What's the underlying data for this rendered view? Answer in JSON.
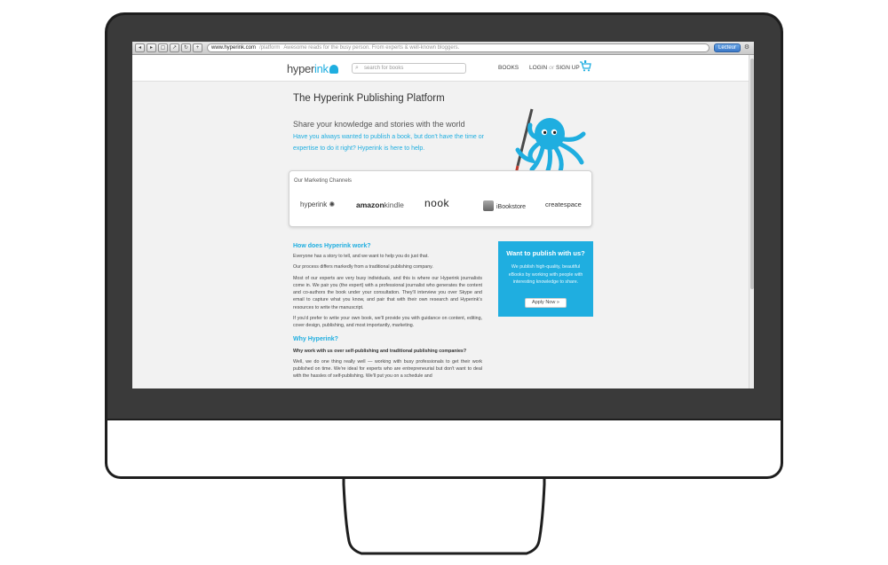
{
  "browser": {
    "url": "www.hyperink.com",
    "url_path": "/platform",
    "title": "Awesome reads for the busy person. From experts & well-known bloggers.",
    "reader_button": "Lecteur",
    "nav_icons": [
      "back-icon",
      "forward-icon",
      "tabs-icon",
      "share-icon",
      "reload-icon",
      "settings-icon"
    ]
  },
  "header": {
    "logo_text": "hyper",
    "logo_accent": "ink",
    "search_placeholder": "search for books",
    "nav_books": "BOOKS",
    "nav_login": "LOGIN",
    "nav_or": "or",
    "nav_signup": "SIGN UP"
  },
  "hero": {
    "title": "The Hyperink Publishing Platform",
    "tagline": "Share your knowledge and stories with the world",
    "intro": "Have you always wanted to publish a book, but don't have the time or expertise to do it right? Hyperink is here to help."
  },
  "channels": {
    "title": "Our Marketing Channels",
    "items": [
      "hyperink",
      "amazon",
      "kindle",
      "nook",
      "iBookstore",
      "createspace"
    ]
  },
  "article": {
    "heading1": "How does Hyperink work?",
    "p1": "Everyone has a story to tell, and we want to help you do just that.",
    "p2": "Our process differs markedly from a traditional publishing company.",
    "p3": "Most of our experts are very busy individuals, and this is where our Hyperink journalists come in. We pair you (the expert) with a professional journalist who generates the content and co-authors the book under your consultation. They'll interview you over Skype and email to capture what you know, and pair that with their own research and Hyperink's resources to write the manuscript.",
    "p4": "If you'd prefer to write your own book, we'll provide you with guidance on content, editing, cover design, publishing, and most importantly, marketing.",
    "heading2": "Why Hyperink?",
    "bold": "Why work with us over self-publishing and traditional publishing companies?",
    "p5": "Well, we do one thing really well — working with busy professionals to get their work published on time. We're ideal for experts who are entrepreneurial but don't want to deal with the hassles of self-publishing. We'll put you on a schedule and"
  },
  "promo": {
    "title": "Want to publish with us?",
    "text": "We publish high-quality, beautiful eBooks by working with people with interesting knowledge to share.",
    "button": "Apply Now »"
  },
  "colors": {
    "accent": "#1faee0",
    "bezel": "#3a3a3a"
  }
}
